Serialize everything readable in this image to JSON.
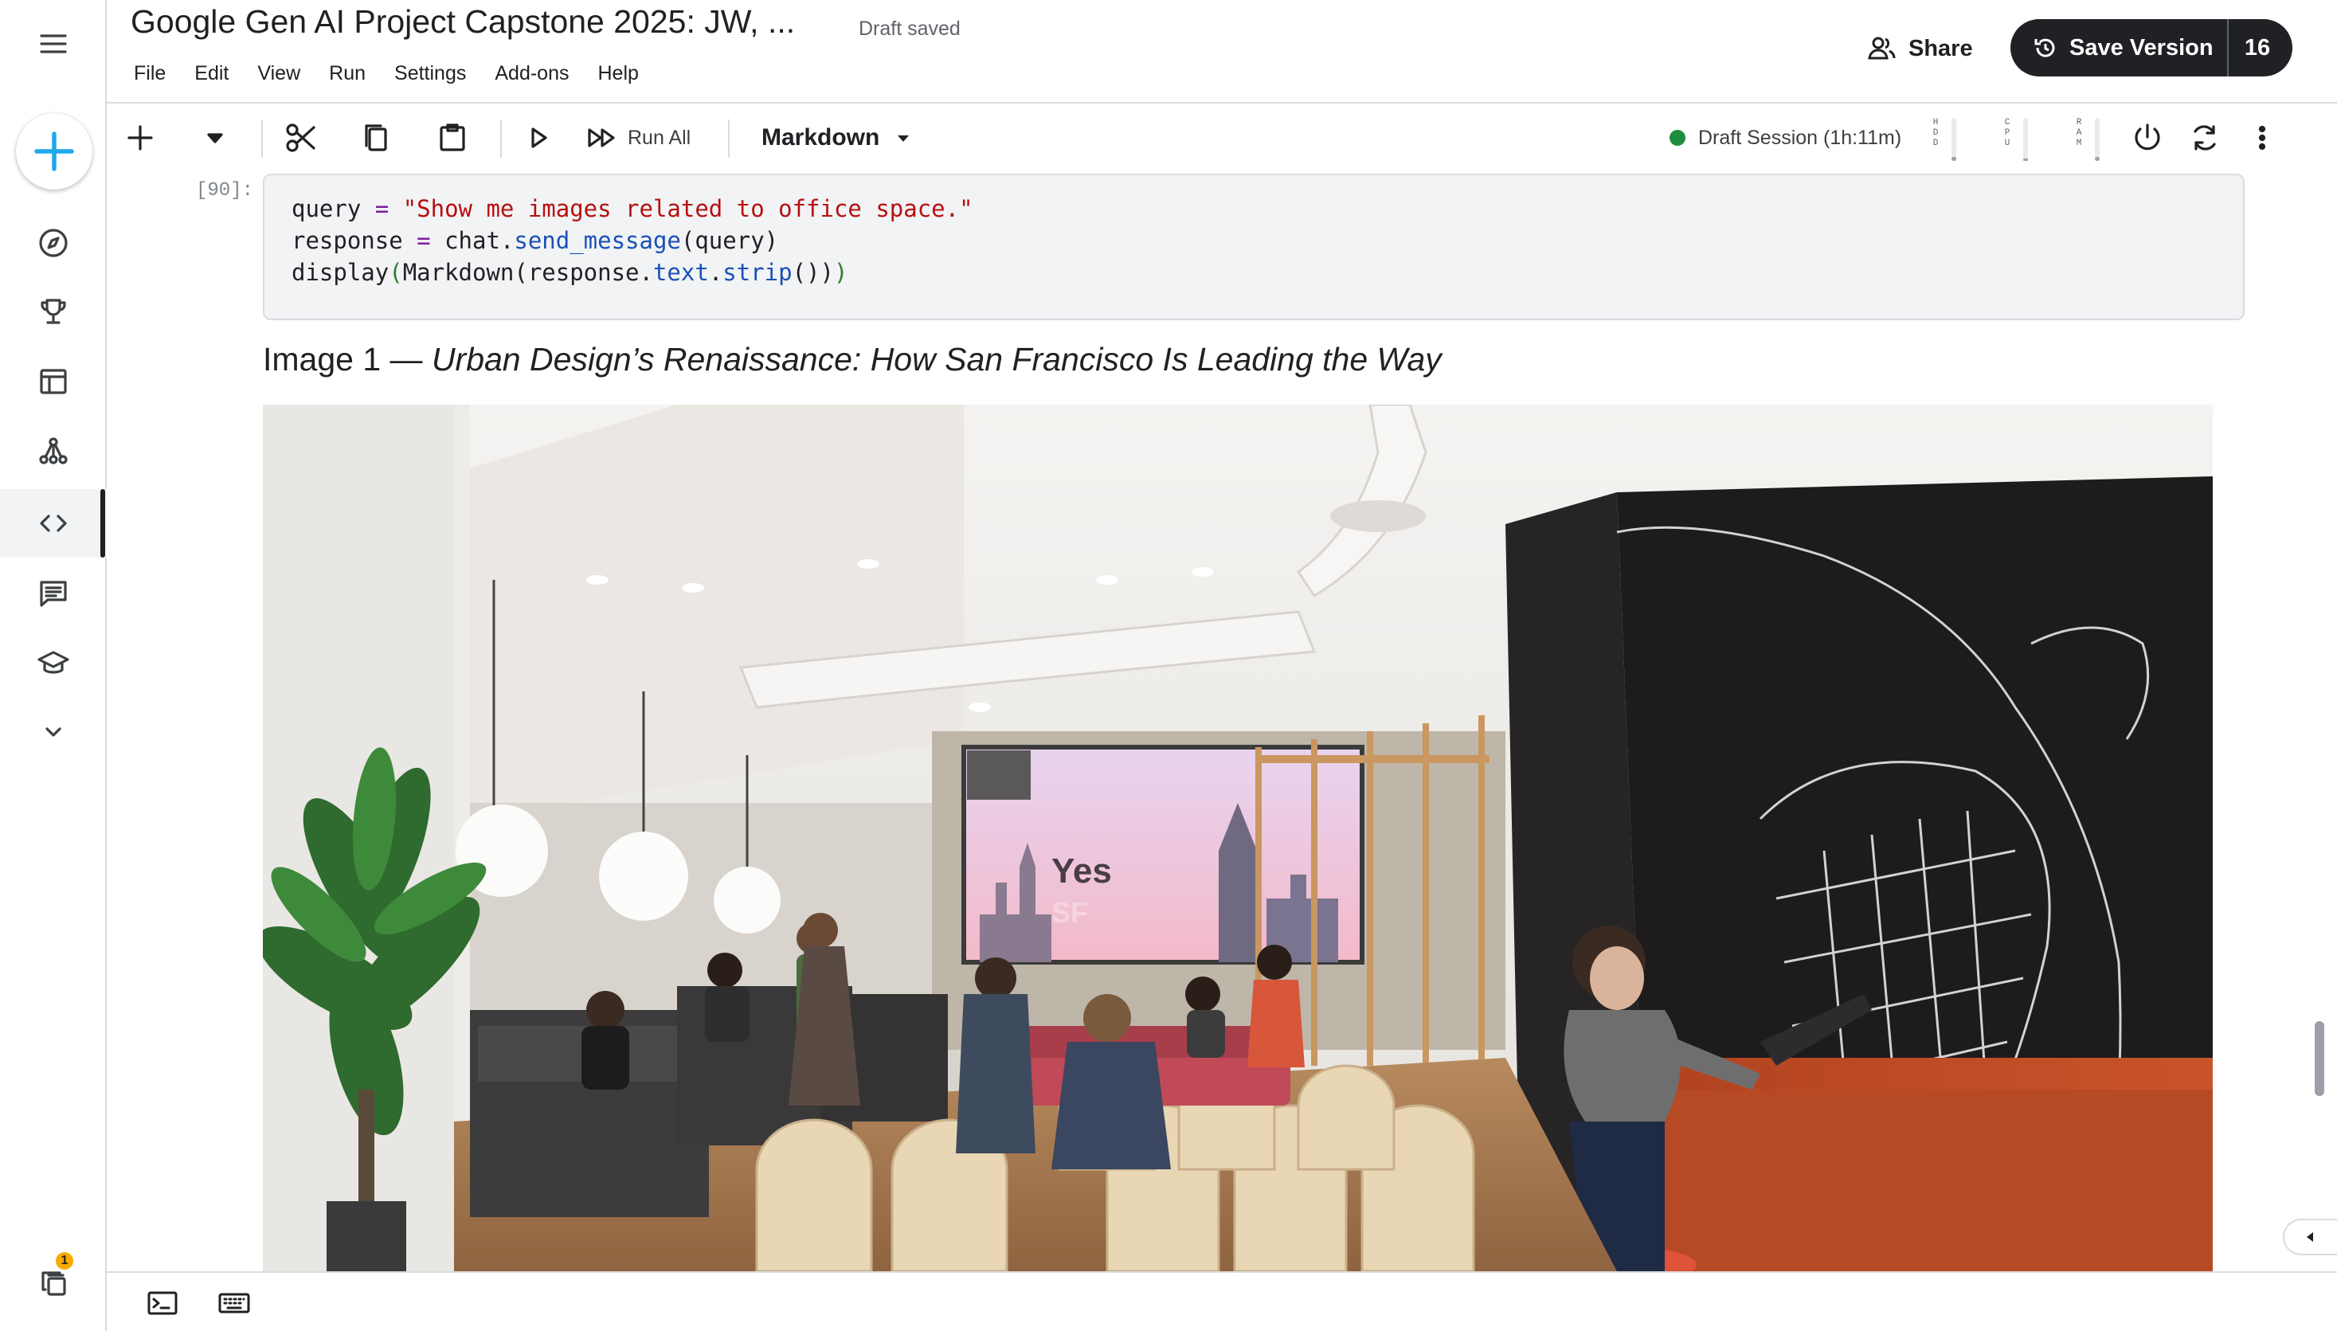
{
  "app": {
    "title": "Google Gen AI Project Capstone 2025: JW, ...",
    "status": "Draft saved"
  },
  "menu": [
    "File",
    "Edit",
    "View",
    "Run",
    "Settings",
    "Add-ons",
    "Help"
  ],
  "header": {
    "share_label": "Share",
    "save_version_label": "Save Version",
    "version_count": "16"
  },
  "sidebar": {
    "items": [
      {
        "name": "create",
        "icon": "plus-icon"
      },
      {
        "name": "explore",
        "icon": "compass-icon"
      },
      {
        "name": "competitions",
        "icon": "trophy-icon"
      },
      {
        "name": "datasets",
        "icon": "table-icon"
      },
      {
        "name": "models",
        "icon": "models-icon"
      },
      {
        "name": "code",
        "icon": "code-icon",
        "active": true
      },
      {
        "name": "discussions",
        "icon": "comments-icon"
      },
      {
        "name": "learn",
        "icon": "school-icon"
      },
      {
        "name": "more",
        "icon": "chevron-down-icon"
      }
    ],
    "notifications_badge": "1"
  },
  "toolbar": {
    "run_all_label": "Run All",
    "cell_type": "Markdown",
    "session_label": "Draft Session (1h:11m)",
    "session_status_color": "#1e8e3e",
    "meters": [
      {
        "label": "HDD",
        "level": 0.1
      },
      {
        "label": "CPU",
        "level": 0.05
      },
      {
        "label": "RAM",
        "level": 0.1
      }
    ]
  },
  "cell": {
    "execution_count": "[90]:",
    "code_lines": [
      "query = \"Show me images related to office space.\"",
      "response = chat.send_message(query)",
      "display(Markdown(response.text.strip()))"
    ]
  },
  "output": {
    "heading_prefix": "Image 1 — ",
    "heading_title": "Urban Design’s Renaissance: How San Francisco Is Leading the Way",
    "photo_screen_text": "Yes",
    "photo_screen_subtext": "SF"
  }
}
